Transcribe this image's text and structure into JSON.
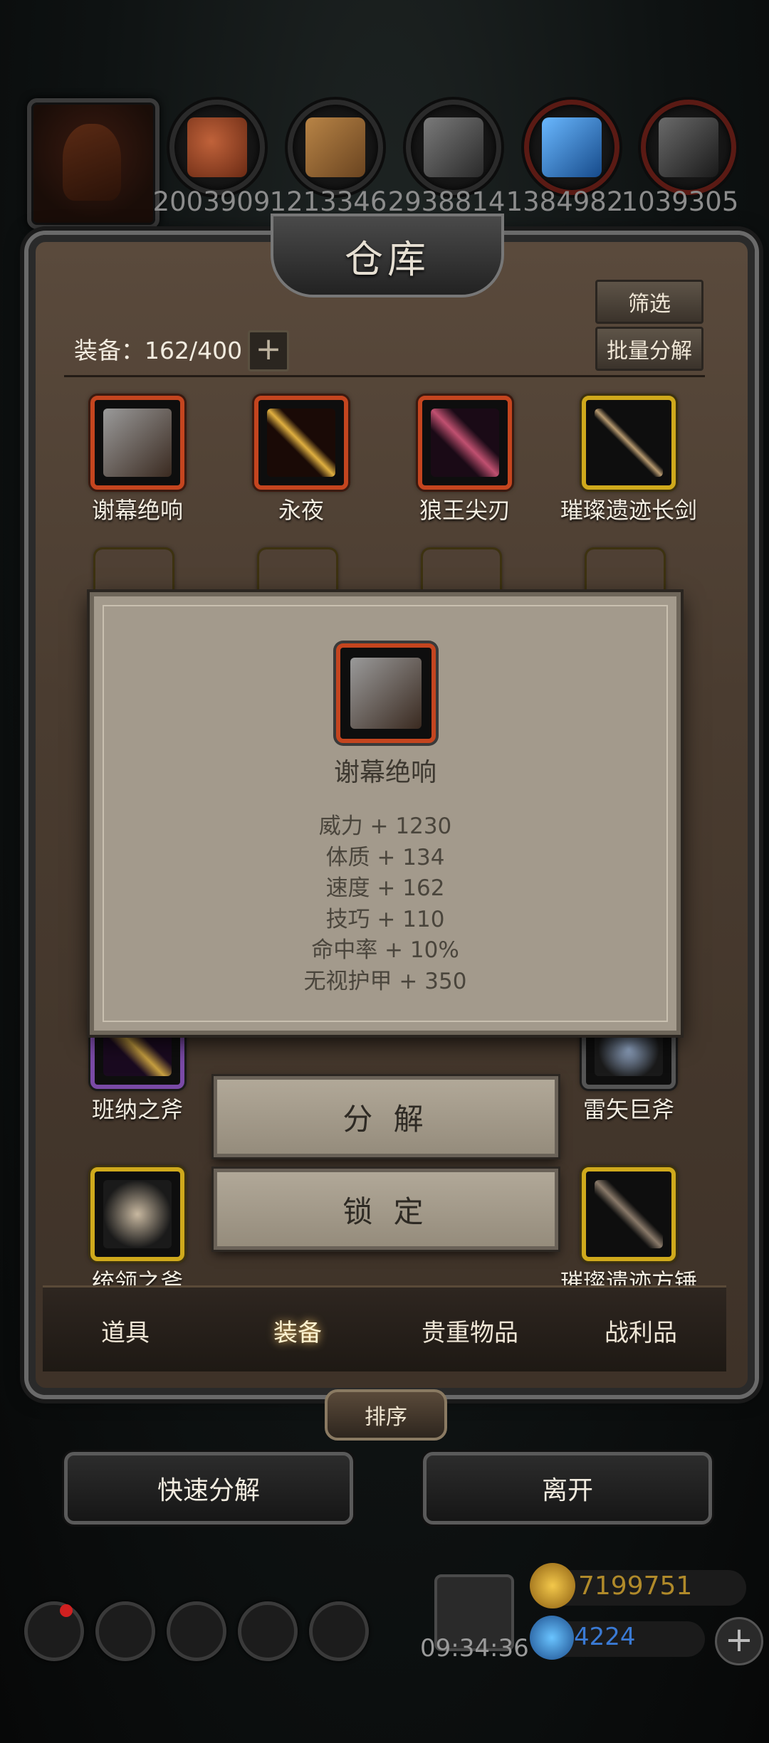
{
  "resources": [
    {
      "icon": "leather-icon",
      "value": "2003909",
      "color": "#b3542a"
    },
    {
      "icon": "wood-icon",
      "value": "1213346",
      "color": "#9a6a34"
    },
    {
      "icon": "iron-icon",
      "value": "2938814",
      "color": "#5a5a5a"
    },
    {
      "icon": "crystal-icon",
      "value": "1384982",
      "color": "#2a78c8"
    },
    {
      "icon": "ore-icon",
      "value": "1039305",
      "color": "#4a4a4a"
    }
  ],
  "warehouse": {
    "title": "仓库",
    "filter_label": "筛选",
    "batch_label": "批量分解",
    "count_label": "装备：162/400",
    "plus": "+"
  },
  "items": [
    {
      "name": "谢幕绝响",
      "rarity": "red",
      "icon": "revolver-icon"
    },
    {
      "name": "永夜",
      "rarity": "red",
      "icon": "dagger-icon"
    },
    {
      "name": "狼王尖刃",
      "rarity": "red",
      "icon": "blade-icon"
    },
    {
      "name": "璀璨遗迹长剑",
      "rarity": "gold",
      "icon": "longsword-icon"
    },
    {
      "name": "班纳之斧",
      "rarity": "purple",
      "icon": "axe-icon"
    },
    {
      "name": "雷矢巨斧",
      "rarity": "gray",
      "icon": "great-axe-icon"
    },
    {
      "name": "统领之斧",
      "rarity": "gold",
      "icon": "battle-axe-icon"
    },
    {
      "name": "璀璨遗迹方锤",
      "rarity": "gold",
      "icon": "hammer-icon"
    }
  ],
  "tabs": [
    {
      "label": "道具"
    },
    {
      "label": "装备"
    },
    {
      "label": "贵重物品"
    },
    {
      "label": "战利品"
    }
  ],
  "sort_label": "排序",
  "quick_decompose_label": "快速分解",
  "leave_label": "离开",
  "timer": "09:34:36",
  "gold": "7199751",
  "gems": "4224",
  "popup": {
    "item_name": "谢幕绝响",
    "stats": [
      "威力 + 1230",
      "体质 + 134",
      "速度 + 162",
      "技巧 + 110",
      "命中率 + 10%",
      "无视护甲 + 350"
    ],
    "decompose_label": "分 解",
    "lock_label": "锁 定"
  }
}
